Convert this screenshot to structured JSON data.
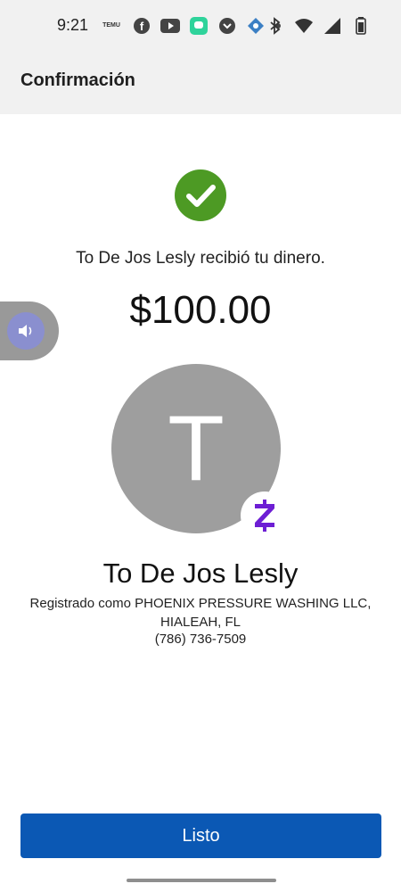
{
  "status_bar": {
    "time": "9:21",
    "temu_label": "TEMU",
    "left_icons": [
      "temu-icon",
      "facebook-icon",
      "youtube-icon",
      "chat-app-icon",
      "pocket-icon",
      "app-icon",
      "dot-icon"
    ],
    "right_icons": [
      "bluetooth-icon",
      "wifi-icon",
      "signal-icon",
      "battery-icon"
    ]
  },
  "header": {
    "title": "Confirmación"
  },
  "confirmation": {
    "message": "To De Jos Lesly recibió tu dinero.",
    "amount": "$100.00"
  },
  "recipient": {
    "initial": "T",
    "name": "To De Jos Lesly",
    "registered_as": "Registrado como PHOENIX PRESSURE WASHING LLC, HIALEAH, FL",
    "phone": "(786) 736-7509"
  },
  "actions": {
    "done_label": "Listo"
  },
  "colors": {
    "success": "#4d9a24",
    "primary": "#0b58b4",
    "zelle": "#6d1ed4",
    "avatar": "#9e9e9e"
  }
}
